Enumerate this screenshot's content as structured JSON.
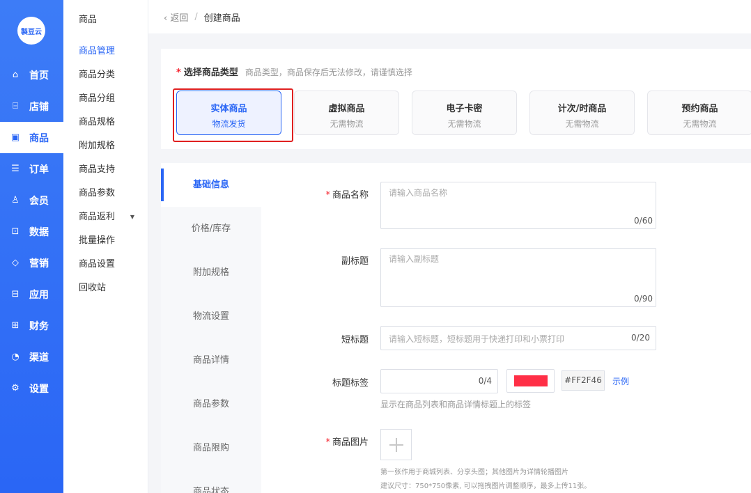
{
  "logo": {
    "text": "製豆云"
  },
  "primary_nav": [
    {
      "icon": "⌂",
      "icon_name": "home-icon",
      "label": "首页"
    },
    {
      "icon": "⌸",
      "icon_name": "shop-icon",
      "label": "店铺"
    },
    {
      "icon": "▣",
      "icon_name": "goods-icon",
      "label": "商品",
      "active": true
    },
    {
      "icon": "☰",
      "icon_name": "order-icon",
      "label": "订单"
    },
    {
      "icon": "♙",
      "icon_name": "member-icon",
      "label": "会员"
    },
    {
      "icon": "⊡",
      "icon_name": "data-icon",
      "label": "数据"
    },
    {
      "icon": "◇",
      "icon_name": "tag-icon",
      "label": "营销"
    },
    {
      "icon": "⊟",
      "icon_name": "app-icon",
      "label": "应用"
    },
    {
      "icon": "⊞",
      "icon_name": "finance-icon",
      "label": "财务"
    },
    {
      "icon": "◔",
      "icon_name": "channel-icon",
      "label": "渠道"
    },
    {
      "icon": "⚙",
      "icon_name": "settings-icon",
      "label": "设置"
    }
  ],
  "secondary_nav": {
    "title": "商品",
    "items": [
      {
        "label": "商品管理",
        "active": true
      },
      {
        "label": "商品分类"
      },
      {
        "label": "商品分组"
      },
      {
        "label": "商品规格"
      },
      {
        "label": "附加规格"
      },
      {
        "label": "商品支持"
      },
      {
        "label": "商品参数"
      },
      {
        "label": "商品返利",
        "caret": "▼"
      },
      {
        "label": "批量操作"
      },
      {
        "label": "商品设置"
      },
      {
        "label": "回收站"
      }
    ]
  },
  "breadcrumb": {
    "back": "返回",
    "separator": "/",
    "current": "创建商品"
  },
  "product_type": {
    "required_mark": "*",
    "label": "选择商品类型",
    "hint": "商品类型，商品保存后无法修改，请谨慎选择",
    "options": [
      {
        "title": "实体商品",
        "sub": "物流发货",
        "active": true
      },
      {
        "title": "虚拟商品",
        "sub": "无需物流"
      },
      {
        "title": "电子卡密",
        "sub": "无需物流"
      },
      {
        "title": "计次/时商品",
        "sub": "无需物流"
      },
      {
        "title": "预约商品",
        "sub": "无需物流"
      }
    ]
  },
  "form_tabs": [
    "基础信息",
    "价格/库存",
    "附加规格",
    "物流设置",
    "商品详情",
    "商品参数",
    "商品限购",
    "商品状态"
  ],
  "form": {
    "required_mark": "*",
    "name": {
      "label": "商品名称",
      "placeholder": "请输入商品名称",
      "count": "0/60"
    },
    "subtitle": {
      "label": "副标题",
      "placeholder": "请输入副标题",
      "count": "0/90"
    },
    "short_title": {
      "label": "短标题",
      "placeholder": "请输入短标题，短标题用于快递打印和小票打印",
      "count": "0/20"
    },
    "title_tag": {
      "label": "标题标签",
      "count": "0/4",
      "color": "#FF2F46",
      "example": "示例",
      "hint": "显示在商品列表和商品详情标题上的标签"
    },
    "image": {
      "label": "商品图片",
      "hint1": "第一张作用于商城列表、分享头图；其他图片为详情轮播图片",
      "hint2": "建议尺寸：750*750像素, 可以拖拽图片调整顺序，最多上传11张。"
    }
  },
  "colors": {
    "accent": "#2a66f5",
    "tag_color": "#FF2F46",
    "required": "#f5222d"
  }
}
